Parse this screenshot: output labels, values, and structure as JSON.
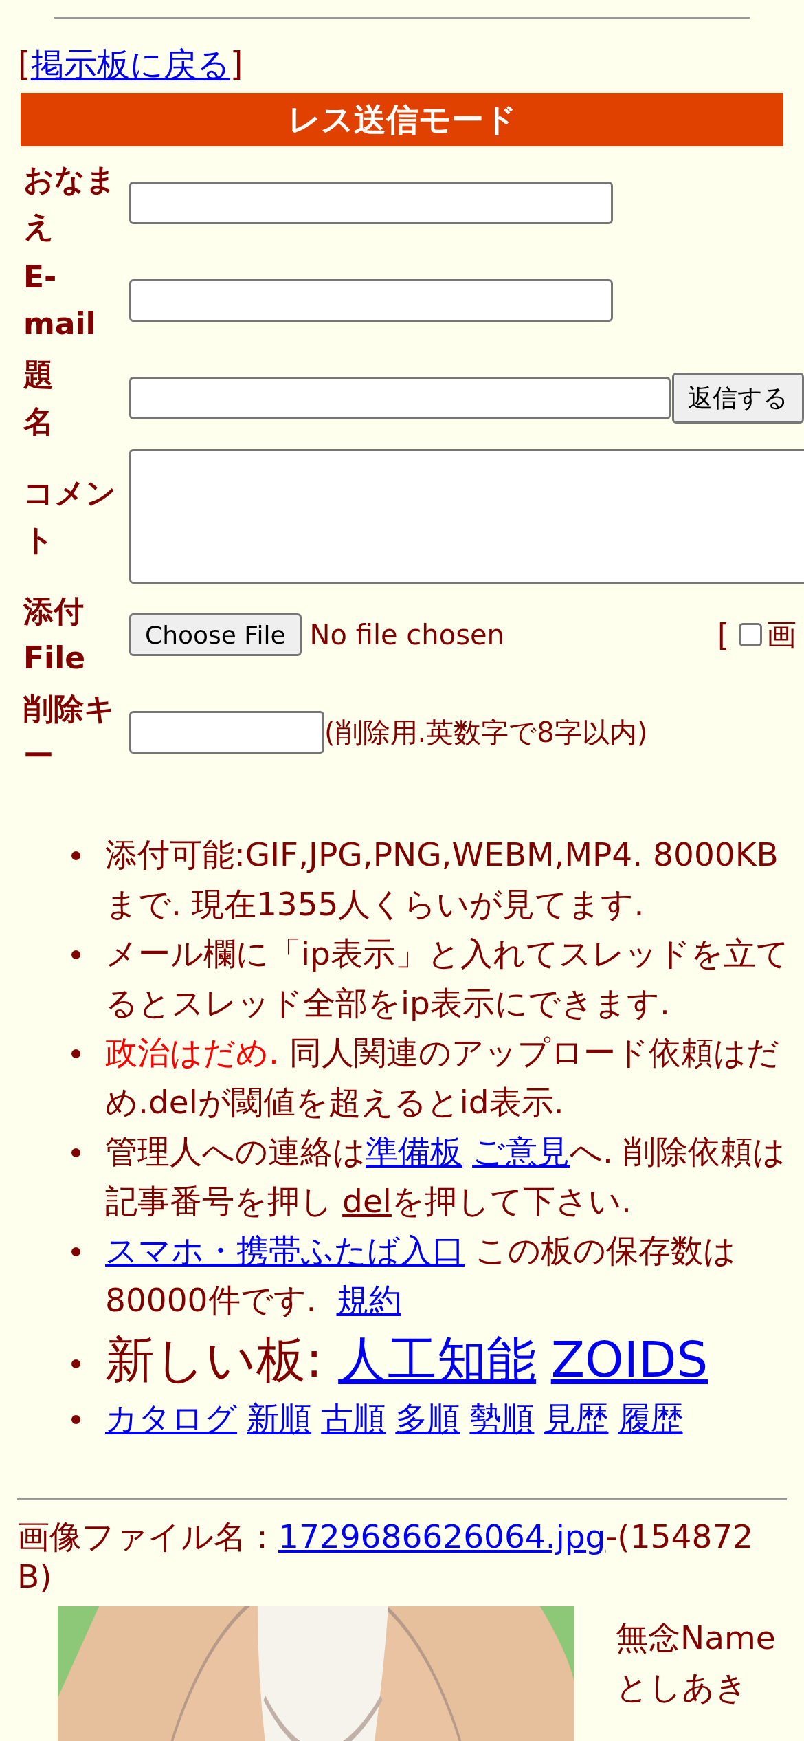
{
  "back_link": {
    "open": "[",
    "label": "掲示板に戻る",
    "close": "]"
  },
  "form_title": "レス送信モード",
  "form": {
    "rows": [
      {
        "kind": "text",
        "label": "おなまえ"
      },
      {
        "kind": "text",
        "label": "E-mail"
      },
      {
        "kind": "subject",
        "label": "題名",
        "button": "返信する"
      },
      {
        "kind": "textarea",
        "label": "コメント"
      },
      {
        "kind": "file",
        "label": "添付File",
        "button": "Choose File",
        "status": "No file chosen",
        "bracket": "[",
        "checkbox_label": "画",
        "checked": false
      },
      {
        "kind": "key",
        "label": "削除キー",
        "hint": "(削除用.英数字で8字以内)"
      }
    ]
  },
  "notices": [
    {
      "kind": "normal",
      "parts": [
        {
          "kind": "text",
          "text": "添付可能:GIF,JPG,PNG,WEBM,MP4. 8000KBまで. 現在1355人くらいが見てます."
        }
      ]
    },
    {
      "kind": "normal",
      "parts": [
        {
          "kind": "text",
          "text": "メール欄に「ip表示」と入れてスレッドを立てるとスレッド全部をip表示にできます."
        }
      ]
    },
    {
      "kind": "normal",
      "parts": [
        {
          "kind": "alert",
          "text": "政治はだめ."
        },
        {
          "kind": "text",
          "text": " 同人関連のアップロード依頼はだめ.delが閾値を超えるとid表示."
        }
      ]
    },
    {
      "kind": "normal",
      "parts": [
        {
          "kind": "text",
          "text": "管理人への連絡は"
        },
        {
          "kind": "link",
          "text": "準備板"
        },
        {
          "kind": "link",
          "text": "ご意見"
        },
        {
          "kind": "text",
          "text": "へ. 削除依頼は記事番号を押し"
        },
        {
          "kind": "plain-link",
          "text": "del"
        },
        {
          "kind": "text",
          "text": "を押して下さい."
        }
      ]
    },
    {
      "kind": "normal",
      "parts": [
        {
          "kind": "link",
          "text": "スマホ・携帯ふたば入口"
        },
        {
          "kind": "text",
          "text": " この板の保存数は80000件です. "
        },
        {
          "kind": "link",
          "text": "規約"
        }
      ]
    },
    {
      "kind": "large",
      "parts": [
        {
          "kind": "text",
          "text": "新しい板: "
        },
        {
          "kind": "link",
          "text": "人工知能"
        },
        {
          "kind": "link",
          "text": "ZOIDS"
        }
      ]
    },
    {
      "kind": "normal",
      "parts": [
        {
          "kind": "link",
          "text": "カタログ"
        },
        {
          "kind": "link",
          "text": "新順"
        },
        {
          "kind": "link",
          "text": "古順"
        },
        {
          "kind": "link",
          "text": "多順"
        },
        {
          "kind": "link",
          "text": "勢順"
        },
        {
          "kind": "link",
          "text": "見歴"
        },
        {
          "kind": "link",
          "text": "履歴"
        }
      ]
    }
  ],
  "post": {
    "file_label": "画像ファイル名：",
    "file_name": "1729686626064.jpg",
    "file_size": "-(154872 B)",
    "subject": "無念",
    "name_label": "Name",
    "name": "としあき"
  }
}
